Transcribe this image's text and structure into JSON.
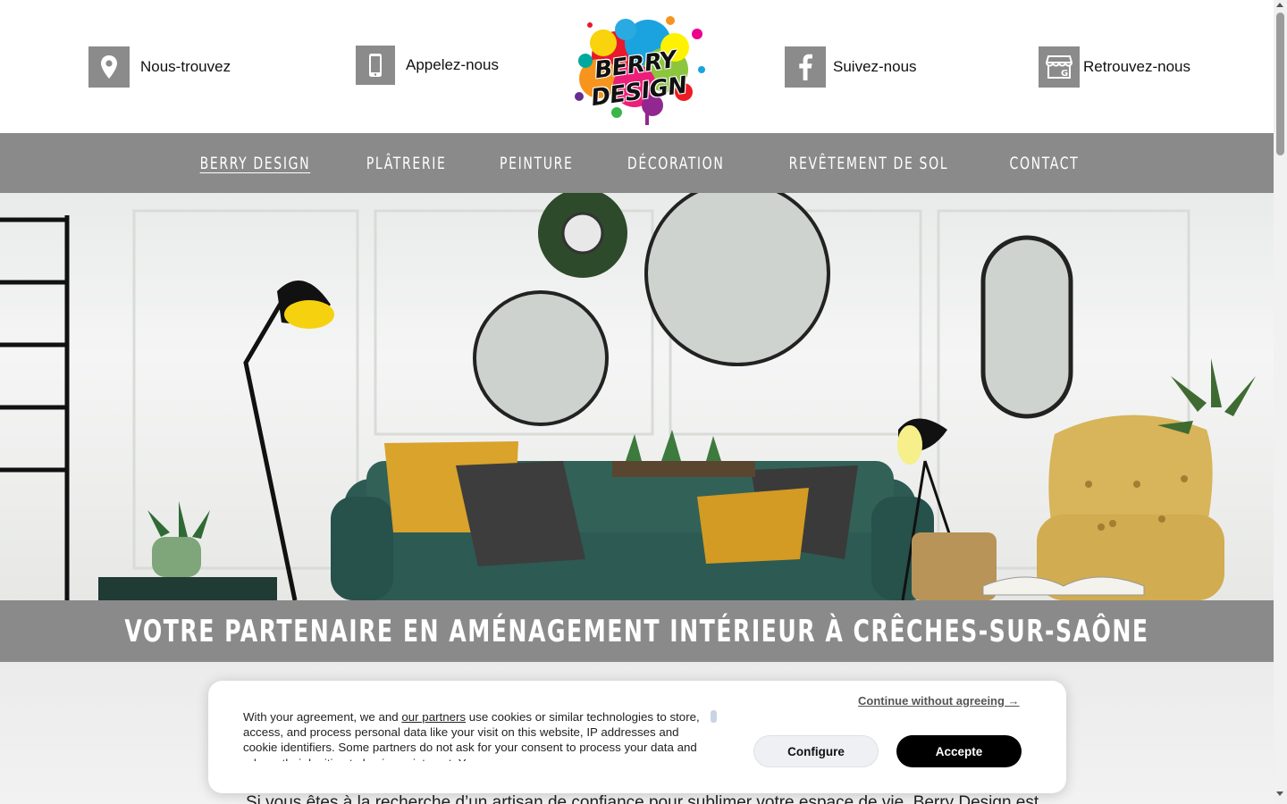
{
  "header": {
    "contacts": [
      {
        "label": "Nous-trouvez",
        "icon": "map-pin-icon"
      },
      {
        "label": "Appelez-nous",
        "icon": "phone-icon"
      },
      {
        "label": "Suivez-nous",
        "icon": "facebook-icon"
      },
      {
        "label": "Retrouvez-nous",
        "icon": "google-business-icon"
      }
    ],
    "logo_text": "BERRY DESIGN"
  },
  "nav": {
    "items": [
      {
        "label": "BERRY DESIGN",
        "active": true
      },
      {
        "label": "PLÂTRERIE"
      },
      {
        "label": "PEINTURE"
      },
      {
        "label": "DÉCORATION"
      },
      {
        "label": "REVÊTEMENT DE SOL"
      },
      {
        "label": "CONTACT"
      }
    ]
  },
  "hero": {
    "banner_title": "VOTRE PARTENAIRE EN AMÉNAGEMENT INTÉRIEUR À CRÊCHES-SUR-SAÔNE"
  },
  "main": {
    "intro_text": "Si vous êtes à la recherche d’un artisan de confiance pour sublimer votre espace de vie, Berry Design est"
  },
  "cookie_banner": {
    "text_before_link": "With your agreement, we and ",
    "link_label": "our partners",
    "text_after_link": " use cookies or similar technologies to store, access, and process personal data like your visit on this website, IP addresses and cookie identifiers. Some partners do not ask for your consent to process your data and rely on their legitimate business interest. You can",
    "continue_label": "Continue without agreeing →",
    "configure_label": "Configure",
    "accept_label": "Accepte"
  },
  "colors": {
    "nav_bg": "#8a8a8a",
    "icon_bg": "#8b8b8b",
    "accent_dark": "#000000"
  }
}
